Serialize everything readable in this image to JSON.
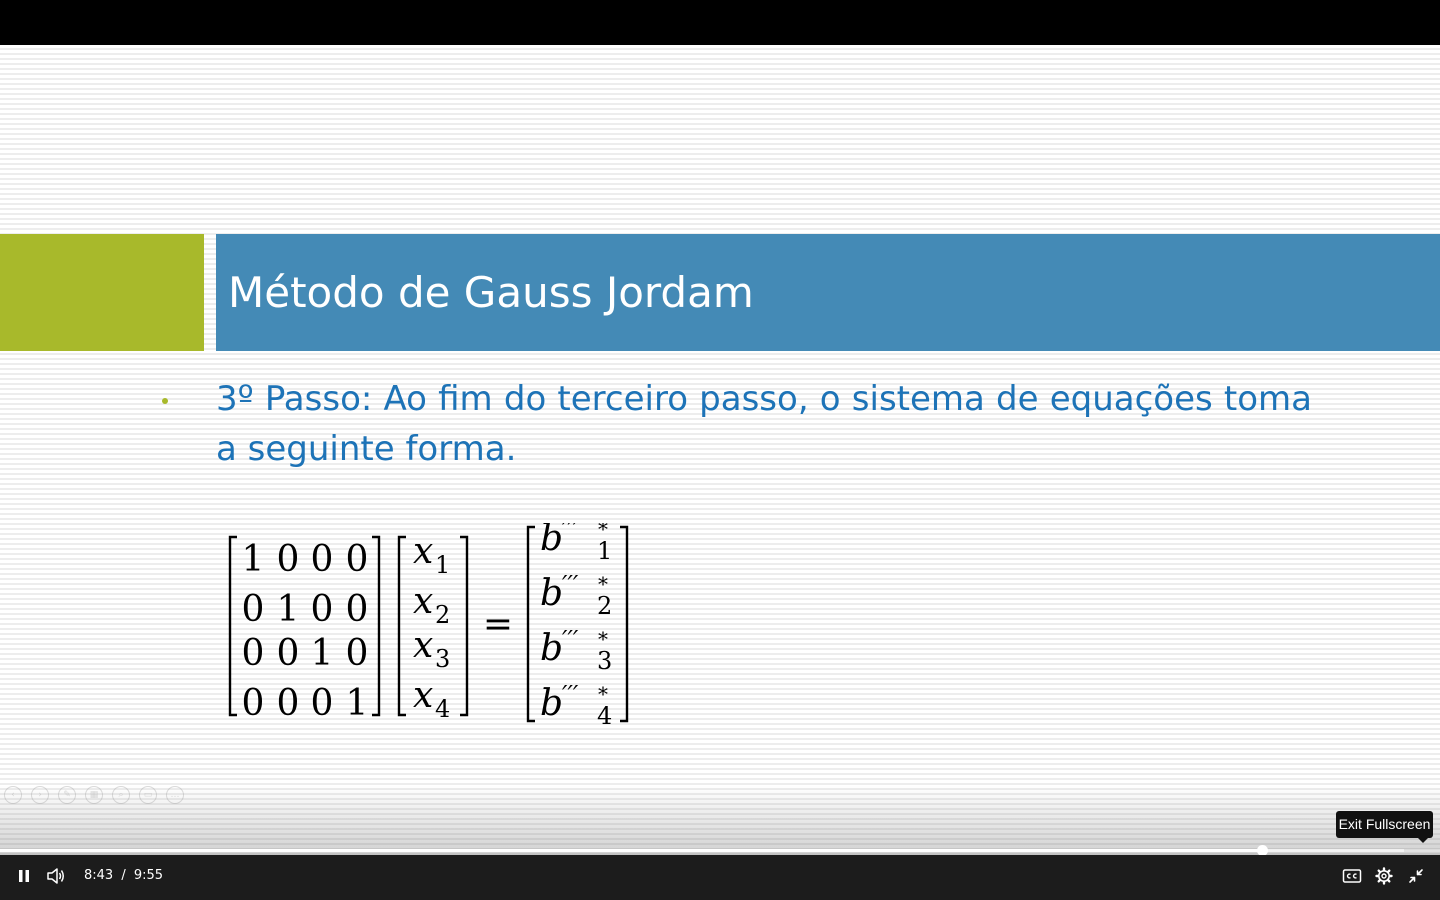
{
  "slide": {
    "title": "Método de Gauss Jordam",
    "bullet_text": "3º Passo: Ao fim do terceiro passo, o sistema de equações toma a seguinte forma.",
    "equation": {
      "matrix": [
        [
          "1",
          "0",
          "0",
          "0"
        ],
        [
          "0",
          "1",
          "0",
          "0"
        ],
        [
          "0",
          "0",
          "1",
          "0"
        ],
        [
          "0",
          "0",
          "0",
          "1"
        ]
      ],
      "unknowns": [
        {
          "base": "x",
          "sub": "1"
        },
        {
          "base": "x",
          "sub": "2"
        },
        {
          "base": "x",
          "sub": "3"
        },
        {
          "base": "x",
          "sub": "4"
        }
      ],
      "equals": "=",
      "rhs": [
        {
          "base": "b",
          "prime": "′′′",
          "sup": "*",
          "sub": "1"
        },
        {
          "base": "b",
          "prime": "′′′",
          "sup": "*",
          "sub": "2"
        },
        {
          "base": "b",
          "prime": "′′′",
          "sup": "*",
          "sub": "3"
        },
        {
          "base": "b",
          "prime": "′′′",
          "sup": "*",
          "sub": "4"
        }
      ]
    },
    "colors": {
      "title_bar": "#448ab6",
      "accent_green": "#a8b92b",
      "bullet_text": "#1d73b7"
    }
  },
  "player": {
    "current_time": "8:43",
    "separator": "/",
    "duration": "9:55",
    "progress_fraction": 0.8765,
    "buffered_fraction": 0.975,
    "tooltip": "Exit Fullscreen",
    "icons": {
      "play_pause": "pause-icon",
      "volume": "volume-icon",
      "captions": "captions-icon",
      "settings": "settings-gear-icon",
      "fullscreen": "exit-fullscreen-icon"
    }
  },
  "slide_nav": {
    "icons": [
      "previous-slide-icon",
      "next-slide-icon",
      "pen-icon",
      "see-all-slides-icon",
      "zoom-icon",
      "subtitles-icon",
      "more-options-icon"
    ]
  }
}
